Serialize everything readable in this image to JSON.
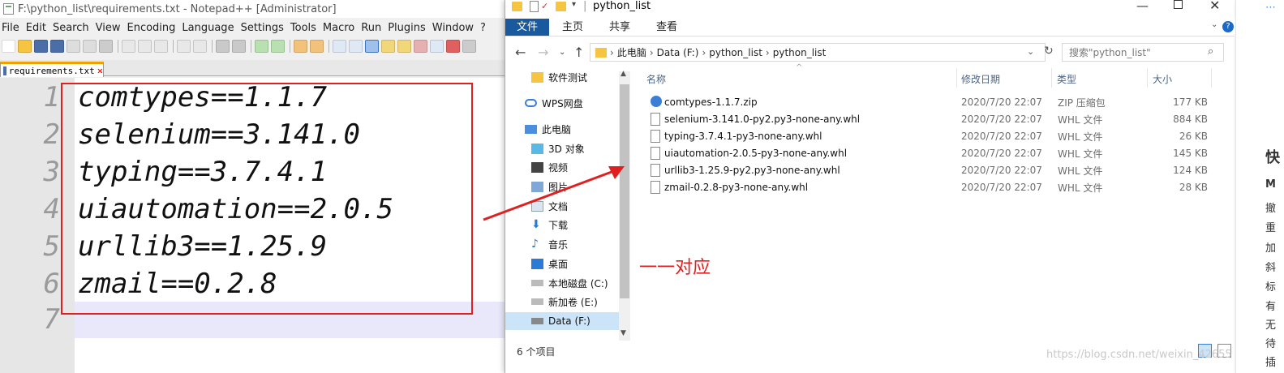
{
  "notepad": {
    "title": "F:\\python_list\\requirements.txt - Notepad++ [Administrator]",
    "menu": [
      "File",
      "Edit",
      "Search",
      "View",
      "Encoding",
      "Language",
      "Settings",
      "Tools",
      "Macro",
      "Run",
      "Plugins",
      "Window",
      "?"
    ],
    "tab_label": "requirements.txt",
    "line_numbers": [
      "1",
      "2",
      "3",
      "4",
      "5",
      "6",
      "7"
    ],
    "lines": [
      "comtypes==1.1.7",
      "selenium==3.141.0",
      "typing==3.7.4.1",
      "uiautomation==2.0.5",
      "urllib3==1.25.9",
      "zmail==0.2.8",
      ""
    ]
  },
  "explorer": {
    "title": "python_list",
    "ribbon_tabs": [
      "文件",
      "主页",
      "共享",
      "查看"
    ],
    "address": {
      "crumbs": [
        "此电脑",
        "Data (F:)",
        "python_list",
        "python_list"
      ]
    },
    "search_placeholder": "搜索\"python_list\"",
    "nav_items": [
      {
        "label": "软件测试",
        "icon": "folder-icon"
      },
      {
        "label": "WPS网盘",
        "icon": "cloud-icon"
      },
      {
        "label": "此电脑",
        "icon": "computer-icon"
      },
      {
        "label": "3D 对象",
        "icon": "cube-icon"
      },
      {
        "label": "视频",
        "icon": "video-icon"
      },
      {
        "label": "图片",
        "icon": "picture-icon"
      },
      {
        "label": "文档",
        "icon": "document-icon"
      },
      {
        "label": "下载",
        "icon": "download-icon"
      },
      {
        "label": "音乐",
        "icon": "music-icon"
      },
      {
        "label": "桌面",
        "icon": "desktop-icon"
      },
      {
        "label": "本地磁盘 (C:)",
        "icon": "drive-icon"
      },
      {
        "label": "新加卷 (E:)",
        "icon": "drive-icon"
      },
      {
        "label": "Data (F:)",
        "icon": "drive-icon"
      }
    ],
    "columns": {
      "name": "名称",
      "date": "修改日期",
      "type": "类型",
      "size": "大小"
    },
    "files": [
      {
        "name": "comtypes-1.1.7.zip",
        "date": "2020/7/20 22:07",
        "type": "ZIP 压缩包",
        "size": "177 KB"
      },
      {
        "name": "selenium-3.141.0-py2.py3-none-any.whl",
        "date": "2020/7/20 22:07",
        "type": "WHL 文件",
        "size": "884 KB"
      },
      {
        "name": "typing-3.7.4.1-py3-none-any.whl",
        "date": "2020/7/20 22:07",
        "type": "WHL 文件",
        "size": "26 KB"
      },
      {
        "name": "uiautomation-2.0.5-py3-none-any.whl",
        "date": "2020/7/20 22:07",
        "type": "WHL 文件",
        "size": "145 KB"
      },
      {
        "name": "urllib3-1.25.9-py2.py3-none-any.whl",
        "date": "2020/7/20 22:07",
        "type": "WHL 文件",
        "size": "124 KB"
      },
      {
        "name": "zmail-0.2.8-py3-none-any.whl",
        "date": "2020/7/20 22:07",
        "type": "WHL 文件",
        "size": "28 KB"
      }
    ],
    "status": "6 个项目"
  },
  "annotation": "一一对应",
  "watermark": "https://blog.csdn.net/weixin_42655",
  "right_strip": [
    "快",
    "M",
    "撤",
    "重",
    "加",
    "斜",
    "标",
    "有",
    "无",
    "待",
    "插"
  ],
  "colors": {
    "accent": "#19599e",
    "annotation": "#e02020"
  }
}
